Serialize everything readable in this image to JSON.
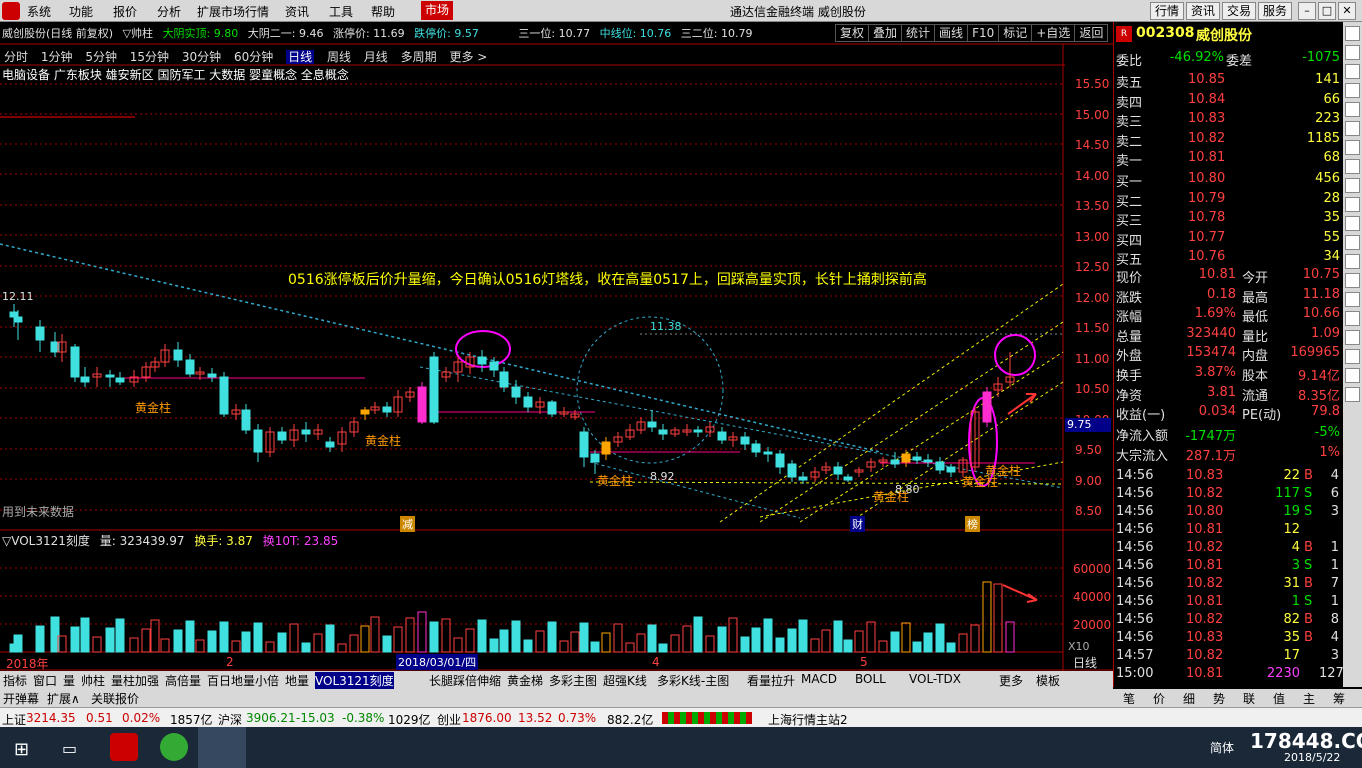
{
  "menu": {
    "items": [
      "系统",
      "功能",
      "报价",
      "分析",
      "扩展市场行情",
      "资讯",
      "工具",
      "帮助"
    ],
    "active": "市场",
    "title": "通达信金融终端  威创股份",
    "right": [
      "行情",
      "资讯",
      "交易",
      "服务"
    ]
  },
  "infobar": {
    "name": "威创股份(日线 前复权)",
    "indicator": "▽帅柱",
    "t1": "大阴实顶: 9.80",
    "t2": "大阴二一: 9.46",
    "t3": "涨停价: 11.69",
    "t4": "跌停价: 9.57",
    "t5": "三一位: 10.77",
    "t6": "中线位: 10.76",
    "t7": "三二位: 10.79"
  },
  "tools": [
    "复权",
    "叠加",
    "统计",
    "画线",
    "F10",
    "标记",
    "+自选",
    "返回"
  ],
  "concepts": "电脑设备 广东板块 雄安新区 国防军工 大数据 婴童概念 全息概念",
  "periods": [
    "分时",
    "1分钟",
    "5分钟",
    "15分钟",
    "30分钟",
    "60分钟",
    "日线",
    "周线",
    "月线",
    "多周期",
    "更多 >"
  ],
  "annotation": "0516涨停板后价升量缩，今日确认0516灯塔线，收在高量0517上，回踩高量实顶，长针上捅刺探前高",
  "chart_labels": {
    "start_price": "12.11",
    "circle_label": "11.38",
    "low_label": "8.92",
    "low2": "8.80",
    "future": "用到未来数据",
    "golden": "黄金柱",
    "marker_jian": "减",
    "marker_cai": "财",
    "marker_bang": "榜",
    "current": "9.75"
  },
  "price_axis": [
    "15.50",
    "15.00",
    "14.50",
    "14.00",
    "13.50",
    "13.00",
    "12.50",
    "12.00",
    "11.50",
    "11.00",
    "10.50",
    "10.00",
    "9.50",
    "9.00",
    "8.50"
  ],
  "vol_axis": [
    "60000",
    "40000",
    "20000",
    "X10"
  ],
  "vol_info": {
    "title": "▽VOL3121刻度",
    "vol": "量: 323439.97",
    "hs": "换手: 3.87",
    "hs10": "换10T: 23.85"
  },
  "date_axis": {
    "d1": "2018年",
    "d2": "2",
    "d3": "2018/03/01/四",
    "d4": "4",
    "d5": "5",
    "period": "日线"
  },
  "bottom_tabs": [
    "指标",
    "窗口",
    "量",
    "帅柱",
    "量柱加强",
    "高倍量",
    "百日地量小倍",
    "地量",
    "VOL3121刻度",
    "长腿踩倍伸缩",
    "黄金梯",
    "多彩主图",
    "超强K线",
    "多彩K线-主图",
    "看量拉升",
    "MACD",
    "BOLL",
    "VOL-TDX",
    "更多",
    "模板"
  ],
  "bottom_tabs2": [
    "开弹幕",
    "扩展∧",
    "关联报价"
  ],
  "side_tabs": [
    "笔",
    "价",
    "细",
    "势",
    "联",
    "值",
    "主",
    "筹"
  ],
  "quote": {
    "code": "002308",
    "name": "威创股份",
    "wb": "-46.92%",
    "wc": "-1075",
    "sells": [
      [
        "卖五",
        "10.85",
        "141"
      ],
      [
        "卖四",
        "10.84",
        "66"
      ],
      [
        "卖三",
        "10.83",
        "223"
      ],
      [
        "卖二",
        "10.82",
        "1185"
      ],
      [
        "卖一",
        "10.81",
        "68"
      ]
    ],
    "buys": [
      [
        "买一",
        "10.80",
        "456"
      ],
      [
        "买二",
        "10.79",
        "28"
      ],
      [
        "买三",
        "10.78",
        "35"
      ],
      [
        "买四",
        "10.77",
        "55"
      ],
      [
        "买五",
        "10.76",
        "34"
      ]
    ],
    "stats": [
      [
        "现价",
        "10.81",
        "今开",
        "10.75"
      ],
      [
        "涨跌",
        "0.18",
        "最高",
        "11.18"
      ],
      [
        "涨幅",
        "1.69%",
        "最低",
        "10.66"
      ],
      [
        "总量",
        "323440",
        "量比",
        "1.09"
      ],
      [
        "外盘",
        "153474",
        "内盘",
        "169965"
      ],
      [
        "换手",
        "3.87%",
        "股本",
        "9.14亿"
      ],
      [
        "净资",
        "3.81",
        "流通",
        "8.35亿"
      ],
      [
        "收益(一)",
        "0.034",
        "PE(动)",
        "79.8"
      ],
      [
        "净流入额",
        "-1747万",
        "",
        "-5%"
      ],
      [
        "大宗流入",
        "287.1万",
        "",
        "1%"
      ]
    ],
    "ticks": [
      [
        "14:56",
        "10.83",
        "22",
        "B",
        "4"
      ],
      [
        "14:56",
        "10.82",
        "117",
        "S",
        "6"
      ],
      [
        "14:56",
        "10.80",
        "19",
        "S",
        "3"
      ],
      [
        "14:56",
        "10.81",
        "12",
        "",
        ""
      ],
      [
        "14:56",
        "10.82",
        "4",
        "B",
        "1"
      ],
      [
        "14:56",
        "10.81",
        "3",
        "S",
        "1"
      ],
      [
        "14:56",
        "10.82",
        "31",
        "B",
        "7"
      ],
      [
        "14:56",
        "10.81",
        "1",
        "S",
        "1"
      ],
      [
        "14:56",
        "10.82",
        "82",
        "B",
        "8"
      ],
      [
        "14:56",
        "10.83",
        "35",
        "B",
        "4"
      ],
      [
        "14:57",
        "10.82",
        "17",
        "",
        "3"
      ],
      [
        "15:00",
        "10.81",
        "2230",
        "",
        "127"
      ]
    ]
  },
  "status": {
    "sh": "上证",
    "sh_v": "3214.35",
    "sh_c": "0.51",
    "sh_p": "0.02%",
    "sh_a": "1857亿",
    "sz": "沪深",
    "sz_v": "3906.21",
    "sz_c": "-15.03",
    "sz_p": "-0.38%",
    "sz_a": "1029亿",
    "cy": "创业",
    "cy_v": "1876.00",
    "cy_c": "13.52",
    "cy_p": "0.73%",
    "cy_a": "882.2亿",
    "station": "上海行情主站2"
  },
  "taskbar": {
    "ime": "简体",
    "date": "2018/5/22",
    "watermark": "178448.COM"
  }
}
